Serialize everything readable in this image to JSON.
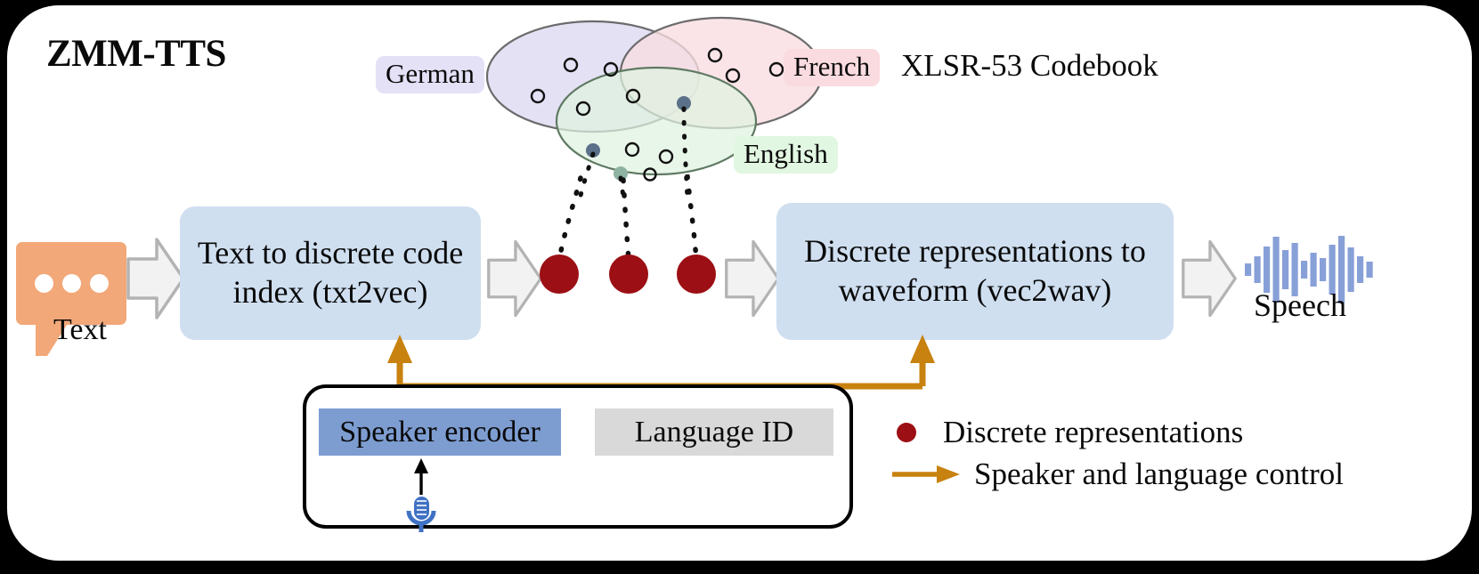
{
  "title": "ZMM-TTS",
  "codebook_label": "XLSR-53 Codebook",
  "venn": {
    "languages": [
      {
        "name": "German",
        "color": "#e4e1f7",
        "ellipse_fill": "#ded9f2"
      },
      {
        "name": "French",
        "color": "#fadbe0",
        "ellipse_fill": "#f8dde2"
      },
      {
        "name": "English",
        "color": "#e2f7e1",
        "ellipse_fill": "#dff2e0"
      }
    ],
    "open_markers": 11,
    "filled_markers": 3
  },
  "pipeline": {
    "input_icon": "speech-bubble-icon",
    "input_label": "Text",
    "stage_1": "Text to discrete code index (txt2vec)",
    "stage_1_line_1": "Text to discrete code",
    "stage_1_line_2": "index (txt2vec)",
    "discrete_tokens": 3,
    "stage_2": "Discrete representations to waveform (vec2wav)",
    "stage_2_line_1": "Discrete representations to",
    "stage_2_line_2": "waveform (vec2wav)",
    "output_icon": "waveform-icon",
    "output_label": "Speech"
  },
  "conditioning": {
    "speaker_encoder": "Speaker encoder",
    "language_id": "Language ID",
    "mic_icon": "microphone-icon"
  },
  "legend": {
    "items": [
      {
        "marker": "red-dot",
        "label": "Discrete representations"
      },
      {
        "marker": "orange-arrow",
        "label": "Speaker and language control"
      }
    ]
  },
  "colors": {
    "box_fill": "#cfdff0",
    "bubble_orange": "#f2a878",
    "discrete_red": "#9c0f14",
    "control_orange": "#c8820f",
    "speaker_blue": "#7d9dd1",
    "langid_grey": "#d9d9d9",
    "wave_blue": "#88a0d8",
    "arrow_grey": "#f2f2f2",
    "arrow_grey_stroke": "#b3b3b3",
    "frame_bg": "#ffffff",
    "page_bg": "#000000"
  },
  "waveform_bars": [
    14,
    30,
    52,
    74,
    44,
    60,
    20,
    38,
    26,
    56,
    76,
    50,
    30,
    18
  ]
}
